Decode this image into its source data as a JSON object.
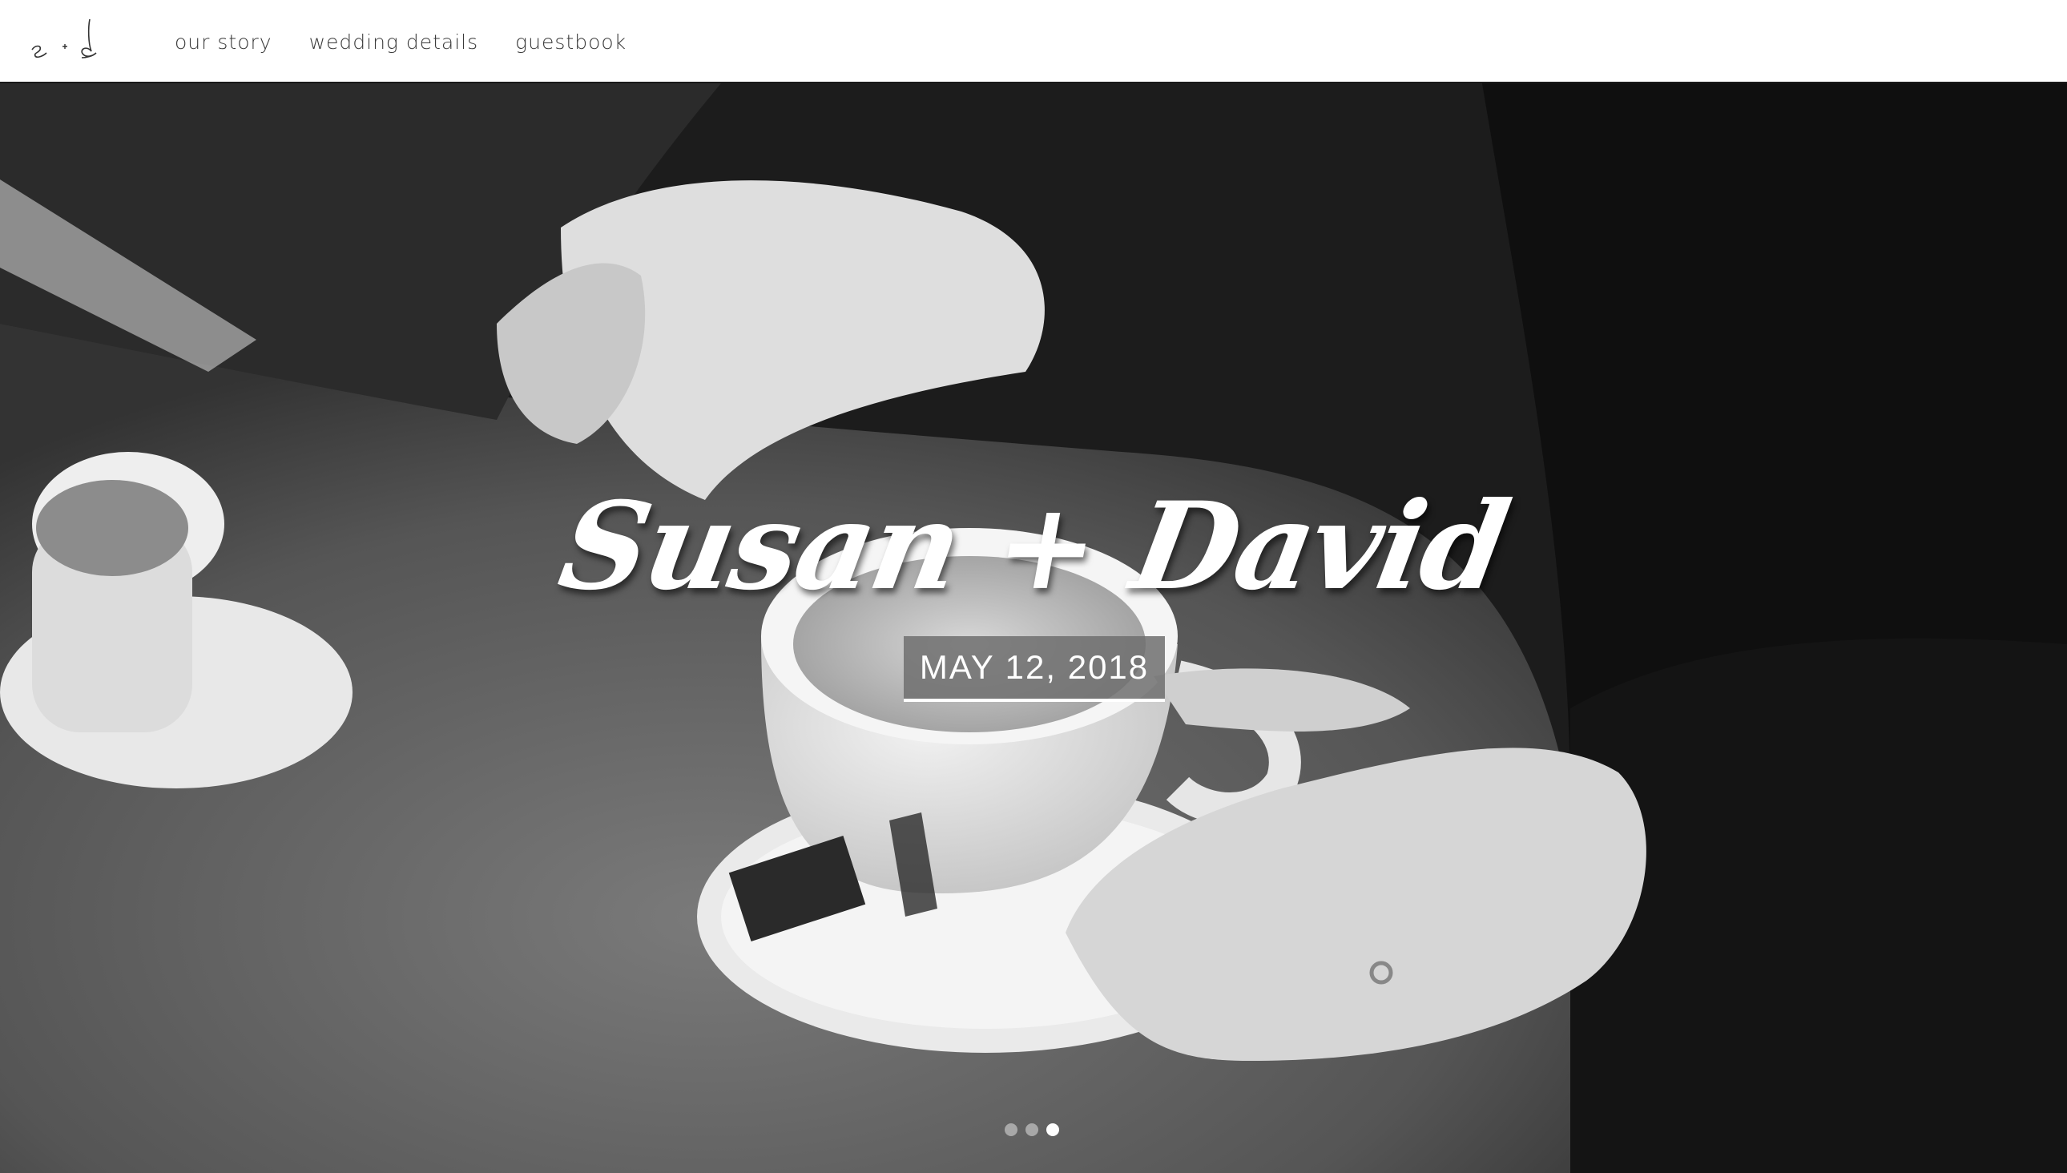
{
  "nav": {
    "links": [
      {
        "label": "our story"
      },
      {
        "label": "wedding details"
      },
      {
        "label": "guestbook"
      }
    ]
  },
  "hero": {
    "title": "Susan + David",
    "date": "MAY 12, 2018",
    "slides": {
      "count": 3,
      "active": 3
    }
  },
  "colors": {
    "accent": "#ffffff",
    "nav_text": "#3a3a3a"
  }
}
